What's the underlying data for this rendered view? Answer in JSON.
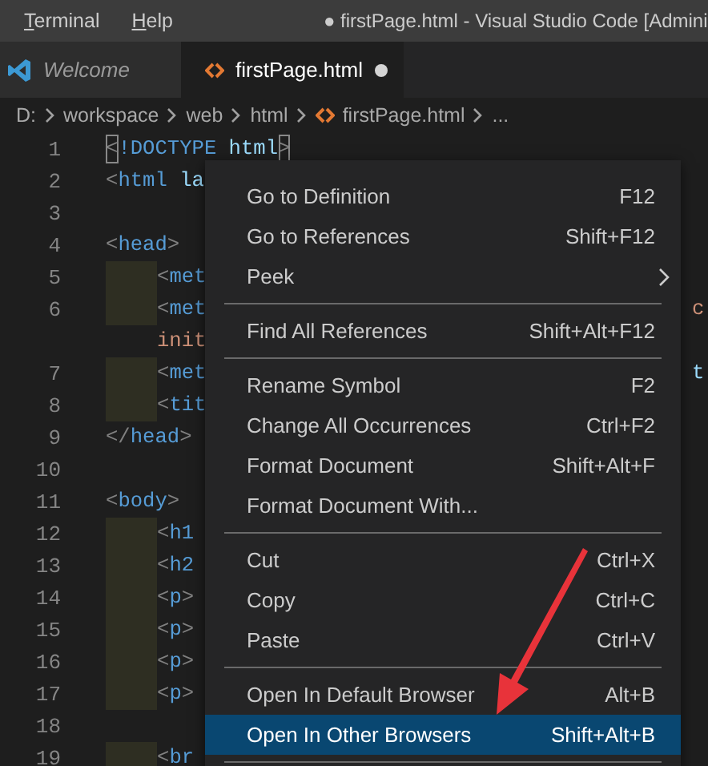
{
  "menu_bar": [
    {
      "mnemonic": "T",
      "rest": "erminal"
    },
    {
      "mnemonic": "H",
      "rest": "elp"
    }
  ],
  "window": {
    "title": "● firstPage.html - Visual Studio Code [Admini"
  },
  "tabs": [
    {
      "label": "Welcome",
      "kind": "welcome",
      "selected": false,
      "modified": false
    },
    {
      "label": "firstPage.html",
      "kind": "html",
      "selected": true,
      "modified": true
    }
  ],
  "breadcrumb": [
    "D:",
    "workspace",
    "web",
    "html",
    "firstPage.html",
    "..."
  ],
  "editor": {
    "rows": [
      {
        "kind": "line",
        "number": "1",
        "indented": false,
        "guide": false,
        "tokens": [
          {
            "kind": "bracket",
            "text": "<"
          },
          {
            "kind": "tag",
            "text": "!DOCTYPE"
          },
          {
            "kind": "attr",
            "text": " html"
          },
          {
            "kind": "bracket",
            "text": ">"
          }
        ]
      },
      {
        "kind": "line",
        "number": "2",
        "indented": false,
        "guide": false,
        "tokens": [
          {
            "kind": "punct",
            "text": "<"
          },
          {
            "kind": "tag",
            "text": "html"
          },
          {
            "kind": "attr",
            "text": " la"
          }
        ]
      },
      {
        "kind": "line",
        "number": "3",
        "tokens": []
      },
      {
        "kind": "line",
        "number": "4",
        "indented": false,
        "guide": false,
        "tokens": [
          {
            "kind": "punct",
            "text": "<"
          },
          {
            "kind": "tag",
            "text": "head"
          },
          {
            "kind": "punct",
            "text": ">"
          }
        ]
      },
      {
        "kind": "line",
        "number": "5",
        "indented": true,
        "guide": true,
        "tokens": [
          {
            "kind": "punct",
            "text": "<"
          },
          {
            "kind": "tag",
            "text": "met"
          }
        ]
      },
      {
        "kind": "line",
        "number": "6",
        "indented": true,
        "guide": true,
        "tokens": [
          {
            "kind": "punct",
            "text": "<"
          },
          {
            "kind": "tag",
            "text": "met"
          }
        ],
        "tail": {
          "kind": "value",
          "text": "c"
        }
      },
      {
        "kind": "wrap",
        "indented": true,
        "guide": false,
        "tokens": [
          {
            "kind": "value",
            "text": "init"
          }
        ]
      },
      {
        "kind": "line",
        "number": "7",
        "indented": true,
        "guide": true,
        "tokens": [
          {
            "kind": "punct",
            "text": "<"
          },
          {
            "kind": "tag",
            "text": "met"
          }
        ],
        "tail": {
          "kind": "attr",
          "text": "t"
        }
      },
      {
        "kind": "line",
        "number": "8",
        "indented": true,
        "guide": true,
        "tokens": [
          {
            "kind": "punct",
            "text": "<"
          },
          {
            "kind": "tag",
            "text": "tit"
          }
        ]
      },
      {
        "kind": "line",
        "number": "9",
        "indented": false,
        "guide": false,
        "tokens": [
          {
            "kind": "punct",
            "text": "</"
          },
          {
            "kind": "tag",
            "text": "head"
          },
          {
            "kind": "punct",
            "text": ">"
          }
        ]
      },
      {
        "kind": "line",
        "number": "10",
        "tokens": []
      },
      {
        "kind": "line",
        "number": "11",
        "indented": false,
        "guide": false,
        "tokens": [
          {
            "kind": "punct",
            "text": "<"
          },
          {
            "kind": "tag",
            "text": "body"
          },
          {
            "kind": "punct",
            "text": ">"
          }
        ]
      },
      {
        "kind": "line",
        "number": "12",
        "indented": true,
        "guide": true,
        "tokens": [
          {
            "kind": "punct",
            "text": "<"
          },
          {
            "kind": "tag",
            "text": "h1"
          }
        ]
      },
      {
        "kind": "line",
        "number": "13",
        "indented": true,
        "guide": true,
        "tokens": [
          {
            "kind": "punct",
            "text": "<"
          },
          {
            "kind": "tag",
            "text": "h2"
          }
        ]
      },
      {
        "kind": "line",
        "number": "14",
        "indented": true,
        "guide": true,
        "tokens": [
          {
            "kind": "punct",
            "text": "<"
          },
          {
            "kind": "tag",
            "text": "p"
          },
          {
            "kind": "punct",
            "text": ">"
          }
        ]
      },
      {
        "kind": "line",
        "number": "15",
        "indented": true,
        "guide": true,
        "tokens": [
          {
            "kind": "punct",
            "text": "<"
          },
          {
            "kind": "tag",
            "text": "p"
          },
          {
            "kind": "punct",
            "text": ">"
          }
        ]
      },
      {
        "kind": "line",
        "number": "16",
        "indented": true,
        "guide": true,
        "tokens": [
          {
            "kind": "punct",
            "text": "<"
          },
          {
            "kind": "tag",
            "text": "p"
          },
          {
            "kind": "punct",
            "text": ">"
          }
        ]
      },
      {
        "kind": "line",
        "number": "17",
        "indented": true,
        "guide": true,
        "tokens": [
          {
            "kind": "punct",
            "text": "<"
          },
          {
            "kind": "tag",
            "text": "p"
          },
          {
            "kind": "punct",
            "text": ">"
          }
        ]
      },
      {
        "kind": "line",
        "number": "18",
        "tokens": []
      },
      {
        "kind": "line",
        "number": "19",
        "indented": true,
        "guide": true,
        "tokens": [
          {
            "kind": "punct",
            "text": "<"
          },
          {
            "kind": "tag",
            "text": "br"
          }
        ]
      }
    ]
  },
  "context_menu": [
    {
      "kind": "item",
      "label": "Go to Definition",
      "shortcut": "F12",
      "selected": false
    },
    {
      "kind": "item",
      "label": "Go to References",
      "shortcut": "Shift+F12",
      "selected": false
    },
    {
      "kind": "submenu",
      "label": "Peek",
      "selected": false
    },
    {
      "kind": "separator"
    },
    {
      "kind": "item",
      "label": "Find All References",
      "shortcut": "Shift+Alt+F12",
      "selected": false
    },
    {
      "kind": "separator"
    },
    {
      "kind": "item",
      "label": "Rename Symbol",
      "shortcut": "F2",
      "selected": false
    },
    {
      "kind": "item",
      "label": "Change All Occurrences",
      "shortcut": "Ctrl+F2",
      "selected": false
    },
    {
      "kind": "item",
      "label": "Format Document",
      "shortcut": "Shift+Alt+F",
      "selected": false
    },
    {
      "kind": "item",
      "label": "Format Document With...",
      "selected": false
    },
    {
      "kind": "separator"
    },
    {
      "kind": "item",
      "label": "Cut",
      "shortcut": "Ctrl+X",
      "selected": false
    },
    {
      "kind": "item",
      "label": "Copy",
      "shortcut": "Ctrl+C",
      "selected": false
    },
    {
      "kind": "item",
      "label": "Paste",
      "shortcut": "Ctrl+V",
      "selected": false
    },
    {
      "kind": "separator"
    },
    {
      "kind": "item",
      "label": "Open In Default Browser",
      "shortcut": "Alt+B",
      "selected": false
    },
    {
      "kind": "item",
      "label": "Open In Other Browsers",
      "shortcut": "Shift+Alt+B",
      "selected": true
    },
    {
      "kind": "separator"
    }
  ]
}
